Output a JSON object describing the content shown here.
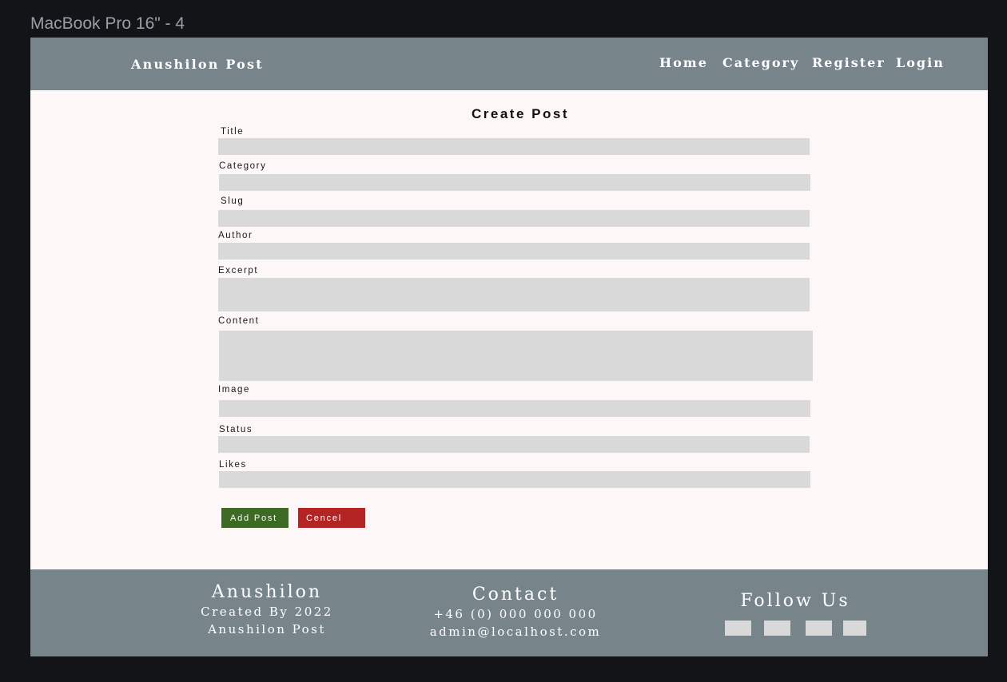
{
  "frame_label": "MacBook Pro 16\" - 4",
  "header": {
    "brand": "Anushilon Post",
    "nav": [
      "Home",
      "Category",
      "Register",
      "Login"
    ]
  },
  "form": {
    "title": "Create Post",
    "fields": {
      "title": "Title",
      "category": "Category",
      "slug": "Slug",
      "author": "Author",
      "excerpt": "Excerpt",
      "content": "Content",
      "image": "Image",
      "status": "Status",
      "likes": "Likes"
    },
    "add_button": "Add Post",
    "cancel_button": "Cencel"
  },
  "footer": {
    "about": {
      "heading": "Anushilon",
      "line1": "Created By 2022",
      "line2": "Anushilon Post"
    },
    "contact": {
      "heading": "Contact",
      "phone": "+46 (0) 000 000 000",
      "email": "admin@localhost.com"
    },
    "follow": {
      "heading": "Follow Us"
    }
  },
  "colors": {
    "header_bg": "#77858b",
    "page_bg": "#fdf7f7",
    "field_bg": "#d9d9d9",
    "add_button": "#3d6a24",
    "cancel_button": "#b52424"
  }
}
